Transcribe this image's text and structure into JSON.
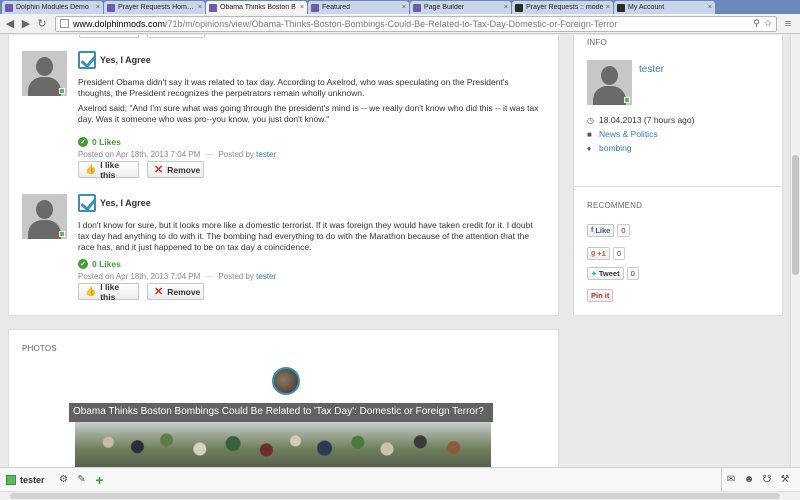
{
  "browser": {
    "tabs": [
      {
        "title": "Dolphin Modules Demo",
        "color": "#6d5ca8",
        "active": false
      },
      {
        "title": "Prayer Requests Home P",
        "color": "#6d5ca8",
        "active": false
      },
      {
        "title": "Obama Thinks Boston B",
        "color": "#6d5ca8",
        "active": true
      },
      {
        "title": "Featured",
        "color": "#6d5ca8",
        "active": false
      },
      {
        "title": "Page Builder",
        "color": "#6d5ca8",
        "active": false
      },
      {
        "title": "Prayer Requests :: mode",
        "color": "#2b2b2b",
        "active": false
      },
      {
        "title": "My Account",
        "color": "#2b2b2b",
        "active": false
      }
    ],
    "url_host": "www.dolphinmods.com",
    "url_path": "/71b/m/opinions/view/Obama-Thinks-Boston-Bombings-Could-Be-Related-to-Tax-Day-Domestic-or-Foreign-Terror"
  },
  "posts": [
    {
      "vote": "Yes, I Agree",
      "paragraphs": [
        "President Obama didn't say it was related to tax day. According to Axelrod, who was speculating on the President's thoughts, the President recognizes the perpetrators remain wholly unknown.",
        "Axelrod said, \"And I'm sure what was going through the president's mind is -- we really don't know who did this -- it was tax day. Was it someone who was pro--you know, you just don't know.\""
      ],
      "likes": "0 Likes",
      "posted_on": "Posted on Apr 18th, 2013 7:04 PM",
      "posted_by_label": "Posted by",
      "author": "tester",
      "like_btn": "I like this",
      "remove_btn": "Remove"
    },
    {
      "vote": "Yes, I Agree",
      "paragraphs": [
        "I don't know for sure, but it looks more like a domestic terrorist. If it was foreign they would have taken credit for it. I doubt tax day had anything to do with it. The bombing had everything to do with the Marathon because of the attention that the race has, and it just happened to be on tax day a coincidence."
      ],
      "likes": "0 Likes",
      "posted_on": "Posted on Apr 18th, 2013 7:04 PM",
      "posted_by_label": "Posted by",
      "author": "tester",
      "like_btn": "I like this",
      "remove_btn": "Remove"
    }
  ],
  "info": {
    "title": "INFO",
    "author": "tester",
    "date": "18.04.2013 (7 hours ago)",
    "category": "News & Politics",
    "tag": "bombing"
  },
  "recommend": {
    "title": "RECOMMEND",
    "fb_label": "Like",
    "fb_count": "0",
    "gplus_label": "+1",
    "gplus_count": "0",
    "tweet_label": "Tweet",
    "tweet_count": "0",
    "pin_label": "Pin it"
  },
  "photos": {
    "title": "PHOTOS",
    "caption": "Obama Thinks Boston Bombings Could Be Related to 'Tax Day': Domestic or Foreign Terror?"
  },
  "dock": {
    "username": "tester"
  }
}
